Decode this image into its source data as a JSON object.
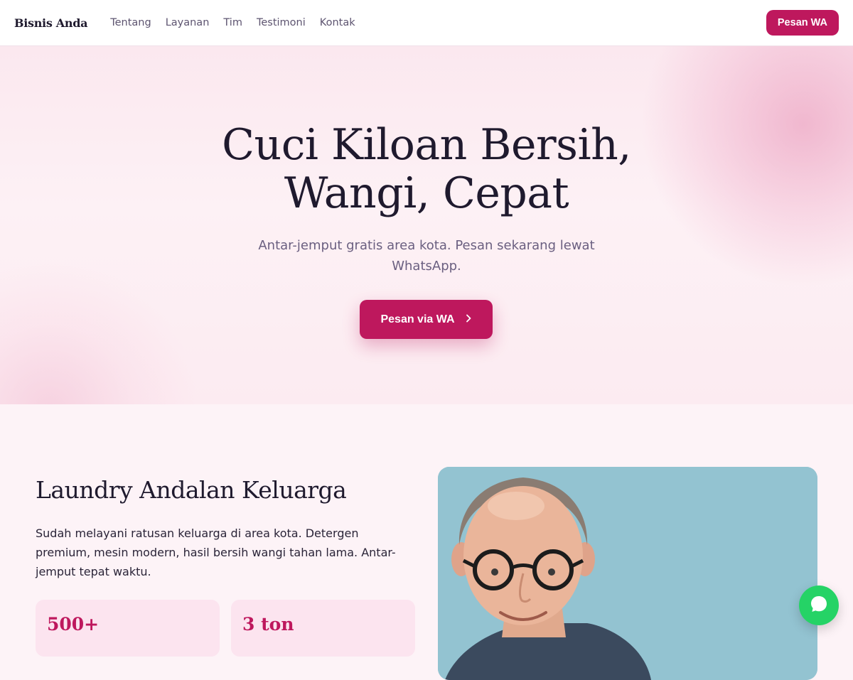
{
  "nav": {
    "brand": "Bisnis Anda",
    "links": [
      "Tentang",
      "Layanan",
      "Tim",
      "Testimoni",
      "Kontak"
    ],
    "cta_label": "Pesan WA"
  },
  "hero": {
    "title": "Cuci Kiloan Bersih, Wangi, Cepat",
    "subtitle": "Antar-jemput gratis area kota. Pesan sekarang lewat WhatsApp.",
    "cta_label": "Pesan via WA",
    "cta_icon": "chevron-right-icon"
  },
  "about": {
    "title": "Laundry Andalan Keluarga",
    "text": "Sudah melayani ratusan keluarga di area kota. Detergen premium, mesin modern, hasil bersih wangi tahan lama. Antar-jemput tepat waktu.",
    "stats": [
      {
        "value": "500+"
      },
      {
        "value": "3 ton"
      }
    ]
  },
  "floating": {
    "icon": "whatsapp-chat-icon"
  },
  "colors": {
    "accent": "#be185d",
    "whatsapp": "#25d366",
    "hero_bg": "#fbe8ef",
    "page_bg": "#fdf3f7",
    "stat_card_bg": "#fce4ef",
    "photo_bg": "#93c3d1"
  }
}
